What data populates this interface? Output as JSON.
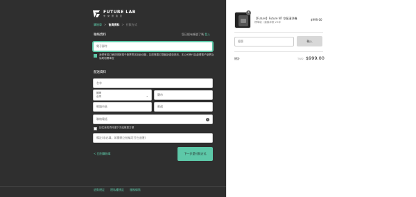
{
  "brand": {
    "name": "FUTURE LAB",
    "sub": "未 來 實 驗 室"
  },
  "breadcrumb": {
    "cart": "購物車",
    "sep1": ">",
    "info": "會員資料",
    "sep2": ">",
    "payment": "付款方式"
  },
  "contact": {
    "title": "聯絡資料",
    "have_account": "您已經有帳號了嗎",
    "login": "登入",
    "email_placeholder": "電子郵件",
    "newsletter_text": "我們會將訂單詳情與電子發票寄送到此信箱，如您需要訂閱最新優惠資訊，本公司會代為處理電子發票及協助相關事宜"
  },
  "shipping": {
    "title": "配送資料",
    "name_placeholder": "名字",
    "country_label": "國家",
    "country_value": "台灣",
    "city_placeholder": "縣市",
    "district_placeholder": "鄉鎮市區",
    "zip_placeholder": "郵遞",
    "phone_placeholder": "聯絡電話",
    "save_info": "記住我的資料讓下次結帳更方便",
    "note_placeholder": "備註(非必填，如需開立統編可打在這喔)"
  },
  "actions": {
    "back": "< 回到購物車",
    "next": "下一步是付款方式"
  },
  "footer": {
    "links": [
      "退款規定",
      "隱私權規定",
      "服務條款"
    ]
  },
  "order": {
    "product_name": "【Future】Future N7 空氣清淨機",
    "product_variant": "標準版 / 建議坪數 25坪",
    "quantity": "1",
    "product_price": "$999.00",
    "coupon_placeholder": "優惠",
    "coupon_button": "輸入",
    "total_label": "總計",
    "currency": "TWD",
    "total": "$999.00"
  },
  "colors": {
    "accent": "#5dc8a8",
    "panel": "#2f2f2f"
  }
}
